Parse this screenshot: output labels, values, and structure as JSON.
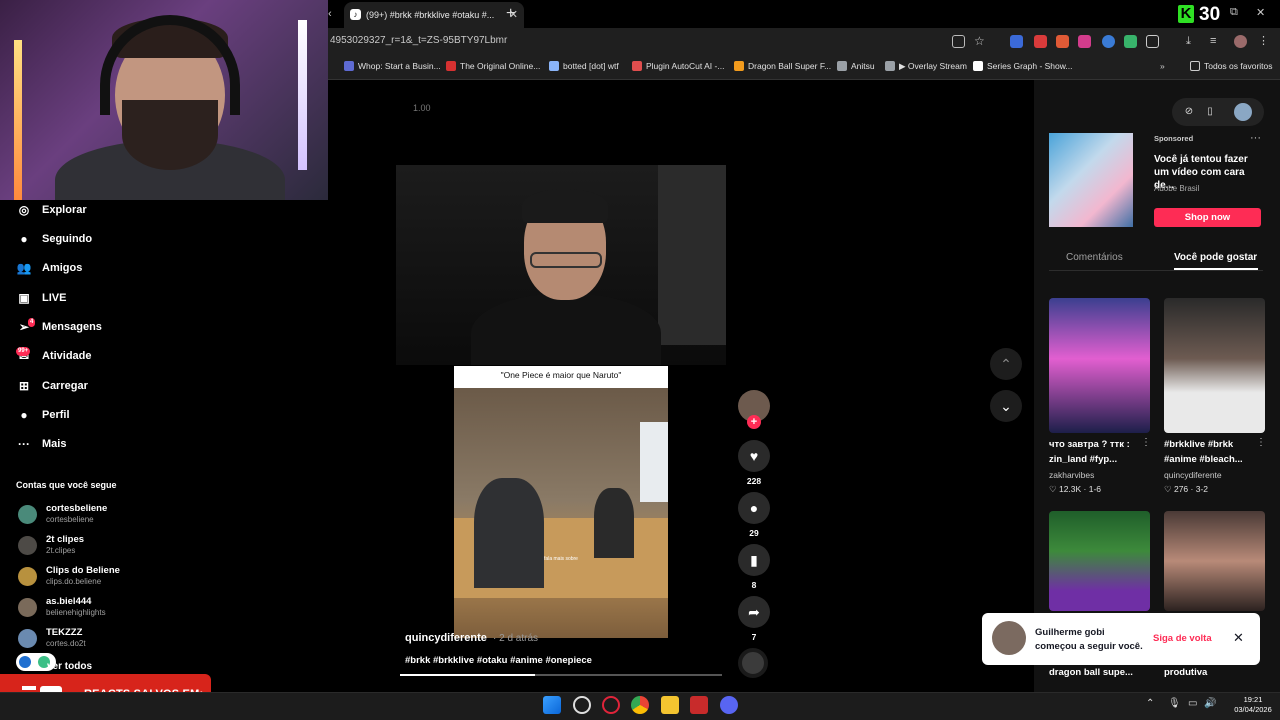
{
  "browser": {
    "tab_title": "(99+) #brkk #brkklive #otaku #...",
    "url": "4953029327_r=1&_t=ZS-95BTY97Lbmr",
    "kick_count": "30",
    "bookmarks": [
      {
        "label": "Whop: Start a Busin...",
        "color": "#5e6ad2"
      },
      {
        "label": "The Original Online...",
        "color": "#d63131"
      },
      {
        "label": "botted [dot] wtf",
        "color": "#8ab4f8"
      },
      {
        "label": "Plugin AutoCut AI -...",
        "color": "#e04e4e"
      },
      {
        "label": "Dragon Ball Super F...",
        "color": "#f29b1d"
      },
      {
        "label": "Anitsu",
        "color": "#9aa0a6"
      },
      {
        "label": "▶ Overlay Stream",
        "color": "#9aa0a6"
      },
      {
        "label": "Series Graph - Show...",
        "color": "#ffffff"
      }
    ],
    "all_bookmarks": "Todos os favoritos"
  },
  "sidebar": {
    "items": [
      {
        "label": "Explorar",
        "icon": "compass-icon",
        "glyph": "◎"
      },
      {
        "label": "Seguindo",
        "icon": "following-icon",
        "glyph": "●"
      },
      {
        "label": "Amigos",
        "icon": "friends-icon",
        "glyph": "👥"
      },
      {
        "label": "LIVE",
        "icon": "live-icon",
        "glyph": "▣"
      },
      {
        "label": "Mensagens",
        "icon": "messages-icon",
        "glyph": "➢"
      },
      {
        "label": "Atividade",
        "icon": "activity-icon",
        "glyph": "✉"
      },
      {
        "label": "Carregar",
        "icon": "upload-icon",
        "glyph": "⊞"
      },
      {
        "label": "Perfil",
        "icon": "profile-icon",
        "glyph": "●"
      },
      {
        "label": "Mais",
        "icon": "more-icon",
        "glyph": "···"
      }
    ],
    "messages_badge": "4",
    "activity_badge": "99+",
    "following_title": "Contas que você segue",
    "accounts": [
      {
        "name": "cortesbeliene",
        "handle": "cortesbeliene",
        "color": "#4a8a7a"
      },
      {
        "name": "2t clipes",
        "handle": "2t.clipes",
        "color": "#4d4a46"
      },
      {
        "name": "Clips do Beliene",
        "handle": "clips.do.beliene",
        "color": "#b8913e"
      },
      {
        "name": "as.biel444",
        "handle": "belienehighlights",
        "color": "#7a6a5a"
      },
      {
        "name": "TEKZZZ",
        "handle": "cortes.do2t",
        "color": "#6a8ab0"
      }
    ],
    "see_all": "ver todos",
    "banner_text": "REACTS SALVOS EM:"
  },
  "video": {
    "time_label": "1.00",
    "inner_caption": "\"One Piece é maior que Naruto\"",
    "inner_subtitle": "fala mais sobre",
    "author": "quincydiferente",
    "posted": "· 2 d atrás",
    "hashtags": "#brkk #brkklive #otaku #anime #onepiece",
    "progress": 0.42,
    "likes": "228",
    "comments": "29",
    "saves": "8",
    "shares": "7"
  },
  "right_panel": {
    "sponsored": "Sponsored",
    "ad_text": "Você já tentou fazer um vídeo com cara de...",
    "ad_brand": "Adobe Brasil",
    "shop_now": "Shop now",
    "tab_comments": "Comentários",
    "tab_foryou": "Você pode gostar",
    "cards": [
      {
        "title": "что завтра ? ттк : zin_land #fyp...",
        "author": "zakharvibes",
        "stats": "♡ 12.3K · 1-6",
        "bg": "linear-gradient(180deg,#3b3f8f,#e25fd0 45%,#1d1f4a)"
      },
      {
        "title": "#brkklive #brkk #anime #bleach...",
        "author": "quincydiferente",
        "stats": "♡ 276 · 3-2",
        "bg": "linear-gradient(180deg,#2a2a2a,#6d5b52 45%,#e9e9e9 70%)"
      },
      {
        "title": "dragon ball supe...",
        "author": "",
        "stats": "",
        "bg": "linear-gradient(180deg,#1f5e2a,#3d8a3b 40%,#6f2fa5 80%)"
      },
      {
        "title": "produtiva",
        "author": "",
        "stats": "",
        "bg": "linear-gradient(180deg,#4a3a36,#b88a78 50%,#2c2220)"
      }
    ]
  },
  "toast": {
    "text": "Guilherme gobi começou a seguir você.",
    "follow_back": "Siga de volta"
  },
  "taskbar": {
    "time": "19:21",
    "date": "03/04/2026"
  }
}
